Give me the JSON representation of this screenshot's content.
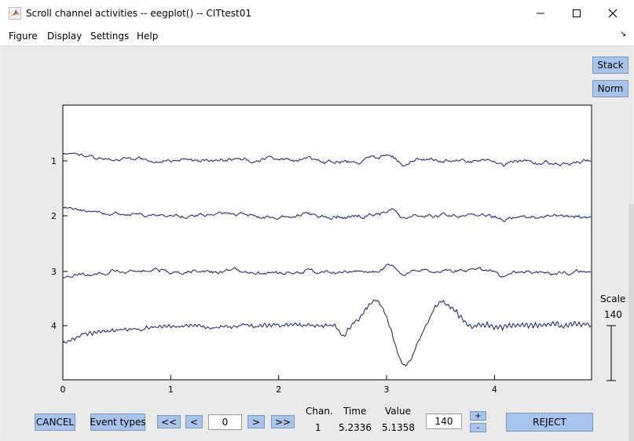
{
  "window": {
    "title": "Scroll channel activities -- eegplot() -- CITtest01"
  },
  "menu": [
    "Figure",
    "Display",
    "Settings",
    "Help"
  ],
  "side_buttons": {
    "stack": "Stack",
    "norm": "Norm"
  },
  "scale": {
    "label": "Scale",
    "value": "140"
  },
  "channels": [
    "1",
    "2",
    "3",
    "4"
  ],
  "x_ticks": [
    "0",
    "1",
    "2",
    "3",
    "4"
  ],
  "x_range": [
    0,
    4.9
  ],
  "bottom": {
    "cancel": "CANCEL",
    "event_types": "Event types",
    "prev_page": "<<",
    "prev": "<",
    "position": "0",
    "next": ">",
    "next_page": ">>",
    "chan_label": "Chan.",
    "time_label": "Time",
    "value_label": "Value",
    "chan_value": "1",
    "time_value": "5.2336",
    "value_value": "5.1358",
    "scale_input": "140",
    "plus": "+",
    "minus": "-",
    "reject": "REJECT"
  },
  "colors": {
    "trace": "#1a1a66",
    "button": "#a6c4ec",
    "axes_bg": "#ffffff"
  }
}
